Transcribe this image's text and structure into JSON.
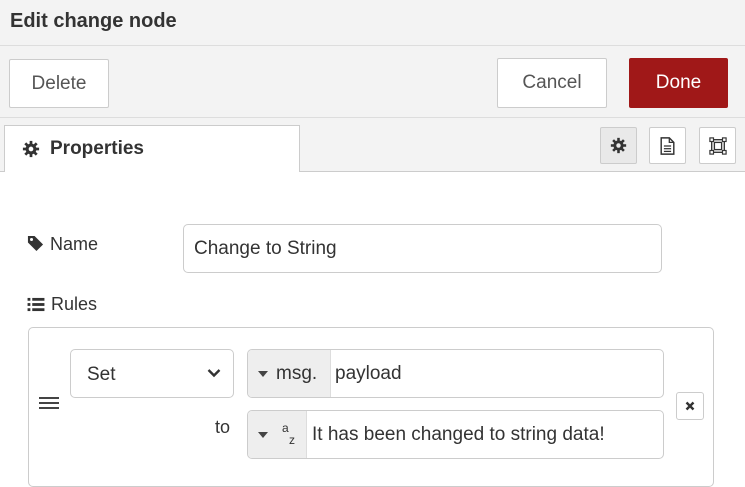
{
  "dialog": {
    "title": "Edit change node"
  },
  "toolbar": {
    "delete_label": "Delete",
    "cancel_label": "Cancel",
    "done_label": "Done"
  },
  "tabs": {
    "properties_label": "Properties",
    "buttons": [
      {
        "icon": "gear-icon",
        "active": true
      },
      {
        "icon": "document-icon",
        "active": false
      },
      {
        "icon": "frame-icon",
        "active": false
      }
    ]
  },
  "form": {
    "name_label": "Name",
    "name_value": "Change to String",
    "rules_label": "Rules"
  },
  "rule": {
    "action": "Set",
    "property_type": "msg.",
    "property_value": "payload",
    "to_label": "to",
    "value_type_icon": "string-az-icon",
    "value": "It has been changed to string data!"
  },
  "colors": {
    "done_button": "#a01818",
    "header_bg": "#f3f3f3",
    "border": "#cccccc"
  }
}
